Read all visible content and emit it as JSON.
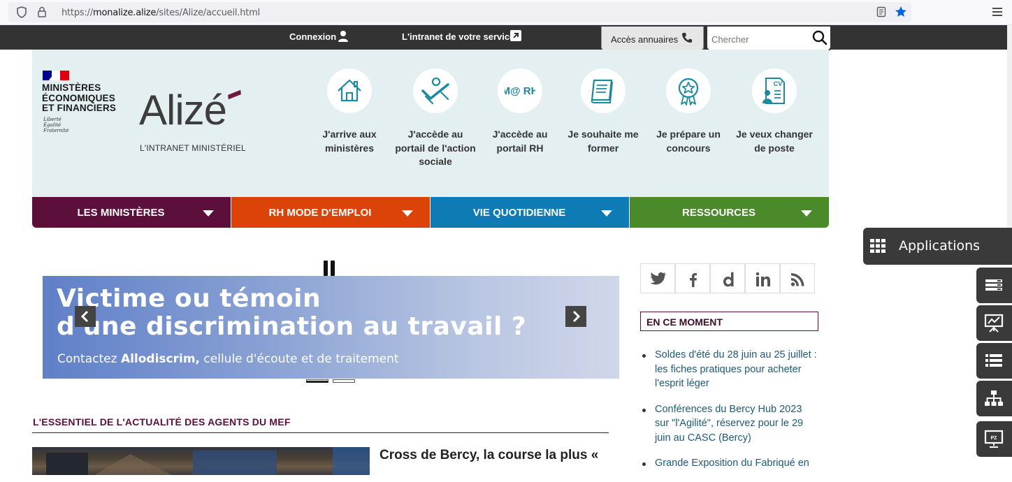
{
  "browser": {
    "url_prefix": "https://",
    "url_domain": "monalize.alize",
    "url_path": "/sites/Alize/accueil.html"
  },
  "topbar": {
    "connexion": "Connexion",
    "intranet_service": "L'intranet de votre service",
    "annuaires": "Accès annuaires",
    "search_placeholder": "Chercher"
  },
  "header": {
    "ministeres": [
      "MINISTÈRES",
      "ÉCONOMIQUES",
      "ET FINANCIERS"
    ],
    "devise": [
      "Liberté",
      "Égalité",
      "Fraternité"
    ],
    "brand": "Alizé",
    "tagline": "L'INTRANET MINISTÉRIEL",
    "quick_links": [
      {
        "label": "J'arrive aux ministères",
        "icon": "house-icon"
      },
      {
        "label": "J'accède au portail de l'action sociale",
        "icon": "handshake-icon"
      },
      {
        "label": "J'accède au portail RH",
        "icon": "mrh-icon",
        "icon_text": "M@ RH"
      },
      {
        "label": "Je souhaite me former",
        "icon": "book-icon"
      },
      {
        "label": "Je prépare un concours",
        "icon": "medal-icon"
      },
      {
        "label": "Je veux changer de poste",
        "icon": "cv-icon",
        "icon_text": "CV"
      }
    ]
  },
  "menu": [
    {
      "label": "LES MINISTÈRES",
      "color": "#5b0f3a"
    },
    {
      "label": "RH MODE D'EMPLOI",
      "color": "#dc4309"
    },
    {
      "label": "VIE QUOTIDIENNE",
      "color": "#0f7bb5"
    },
    {
      "label": "RESSOURCES",
      "color": "#4b8a2a"
    }
  ],
  "carousel": {
    "line1": "Victime ou témoin",
    "line2": "d'une discrimination au travail ?",
    "sub_before": "Contactez ",
    "sub_bold": "Allodiscrim,",
    "sub_after": " cellule d'écoute et de traitement",
    "slides_total": 2,
    "active_slide": 1
  },
  "main": {
    "section_title": "L'ESSENTIEL DE L'ACTUALITÉ DES AGENTS DU MEF",
    "news_title": "Cross de Bercy, la course la plus «"
  },
  "sidebar": {
    "social_icons": [
      "twitter-icon",
      "facebook-icon",
      "dailymotion-icon",
      "linkedin-icon",
      "rss-icon"
    ],
    "en_ce_moment": "EN CE MOMENT",
    "news": [
      "Soldes d'été du 28 juin au 25 juillet : les fiches pratiques pour acheter l'esprit léger",
      "Conférences du Bercy Hub 2023 sur \"l'Agilité\", réservez pour le 29 juin au CASC (Bercy)",
      "Grande Exposition du Fabriqué en"
    ]
  },
  "side_panel": {
    "applications": "Applications",
    "buttons": [
      "stack-icon",
      "presentation-icon",
      "list-icon",
      "sitemap-icon",
      "screen-pz-icon"
    ],
    "pz_label": "PZ"
  }
}
